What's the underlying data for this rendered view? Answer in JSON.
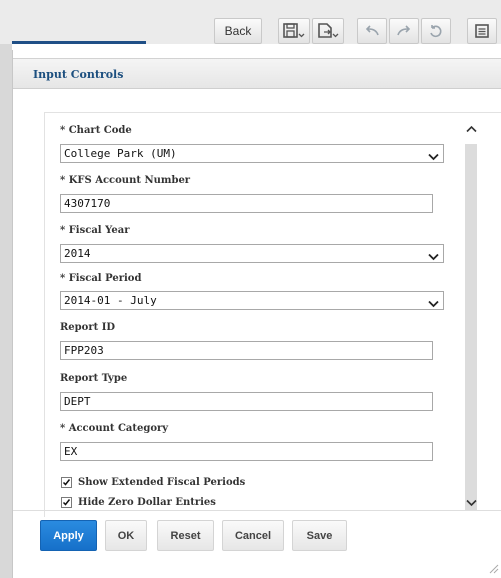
{
  "toolbar": {
    "back_label": "Back",
    "icons": [
      "save-icon",
      "export-icon",
      "undo-icon",
      "redo-icon",
      "revert-icon",
      "options-icon"
    ]
  },
  "dialog": {
    "title": "Input Controls"
  },
  "form": {
    "chart_code": {
      "label": "* Chart Code",
      "value": "College Park (UM)"
    },
    "kfs_account_number": {
      "label": "* KFS Account Number",
      "value": "4307170"
    },
    "fiscal_year": {
      "label": "* Fiscal Year",
      "value": "2014"
    },
    "fiscal_period": {
      "label": "* Fiscal Period",
      "value": "2014-01 - July"
    },
    "report_id": {
      "label": "Report ID",
      "value": "FPP203"
    },
    "report_type": {
      "label": "Report Type",
      "value": "DEPT"
    },
    "account_category": {
      "label": "* Account Category",
      "value": "EX"
    },
    "show_extended": {
      "label": "Show Extended Fiscal Periods",
      "checked": true
    },
    "hide_zero": {
      "label": "Hide Zero Dollar Entries",
      "checked": true
    }
  },
  "buttons": {
    "apply": "Apply",
    "ok": "OK",
    "reset": "Reset",
    "cancel": "Cancel",
    "save": "Save"
  },
  "colors": {
    "accent": "#1c4f7f",
    "primary_button": "#1f7dd6"
  }
}
